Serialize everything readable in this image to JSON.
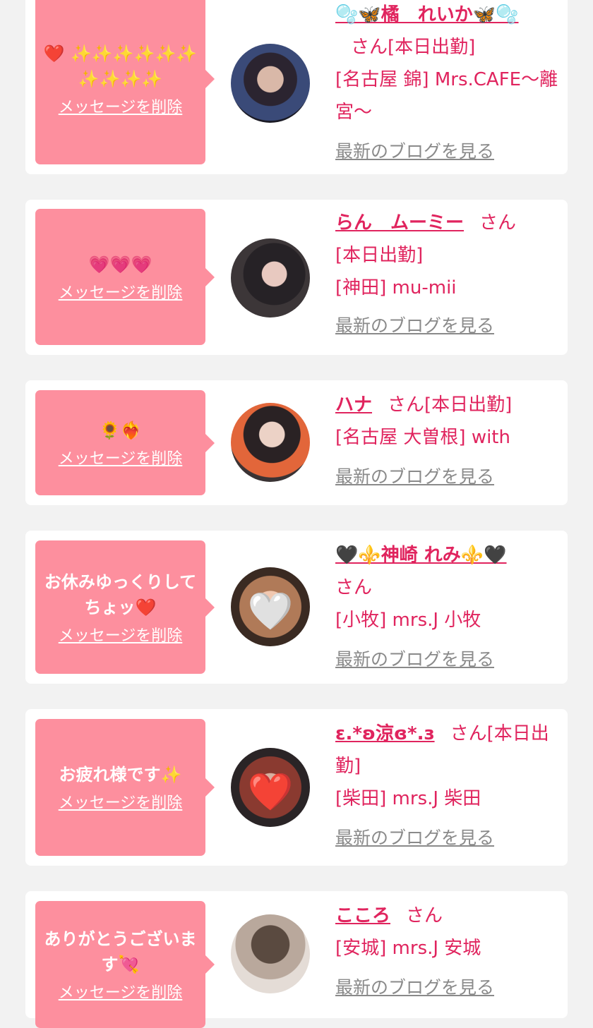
{
  "delete_label": "メッセージを削除",
  "blog_label": "最新のブログを見る",
  "san_label": "さん",
  "colors": {
    "background": "#f2f2f2",
    "card": "#ffffff",
    "bubble": "#fd8f9e",
    "accent": "#e0245e",
    "link_gray": "#8a8a8a"
  },
  "messages": [
    {
      "message": "❤️ ✨✨✨✨✨✨ ✨✨✨✨",
      "name": "🫧🦋橘　れいか🦋🫧",
      "status": "[本日出勤]",
      "shop": "[名古屋 錦] Mrs.CAFE〜離宮〜"
    },
    {
      "message": "💗💗💗",
      "name": "らん　ムーミー",
      "status": "[本日出勤]",
      "shop": "[神田] mu-mii"
    },
    {
      "message": "🌻❤️‍🔥",
      "name": "ハナ",
      "status": "[本日出勤]",
      "shop": "[名古屋 大曽根] with"
    },
    {
      "message": "お休みゆっくりしてちょッ❤️",
      "name": "🖤⚜️神崎 れみ⚜️🖤",
      "status": "",
      "shop": "[小牧] mrs.J 小牧"
    },
    {
      "message": "お疲れ様です✨",
      "name": "ε.*ʚ涼ɞ*.з",
      "status": "[本日出勤]",
      "shop": "[柴田] mrs.J 柴田"
    },
    {
      "message": "ありがとうございます💘",
      "name": "こころ",
      "status": "",
      "shop": "[安城] mrs.J 安城"
    }
  ]
}
